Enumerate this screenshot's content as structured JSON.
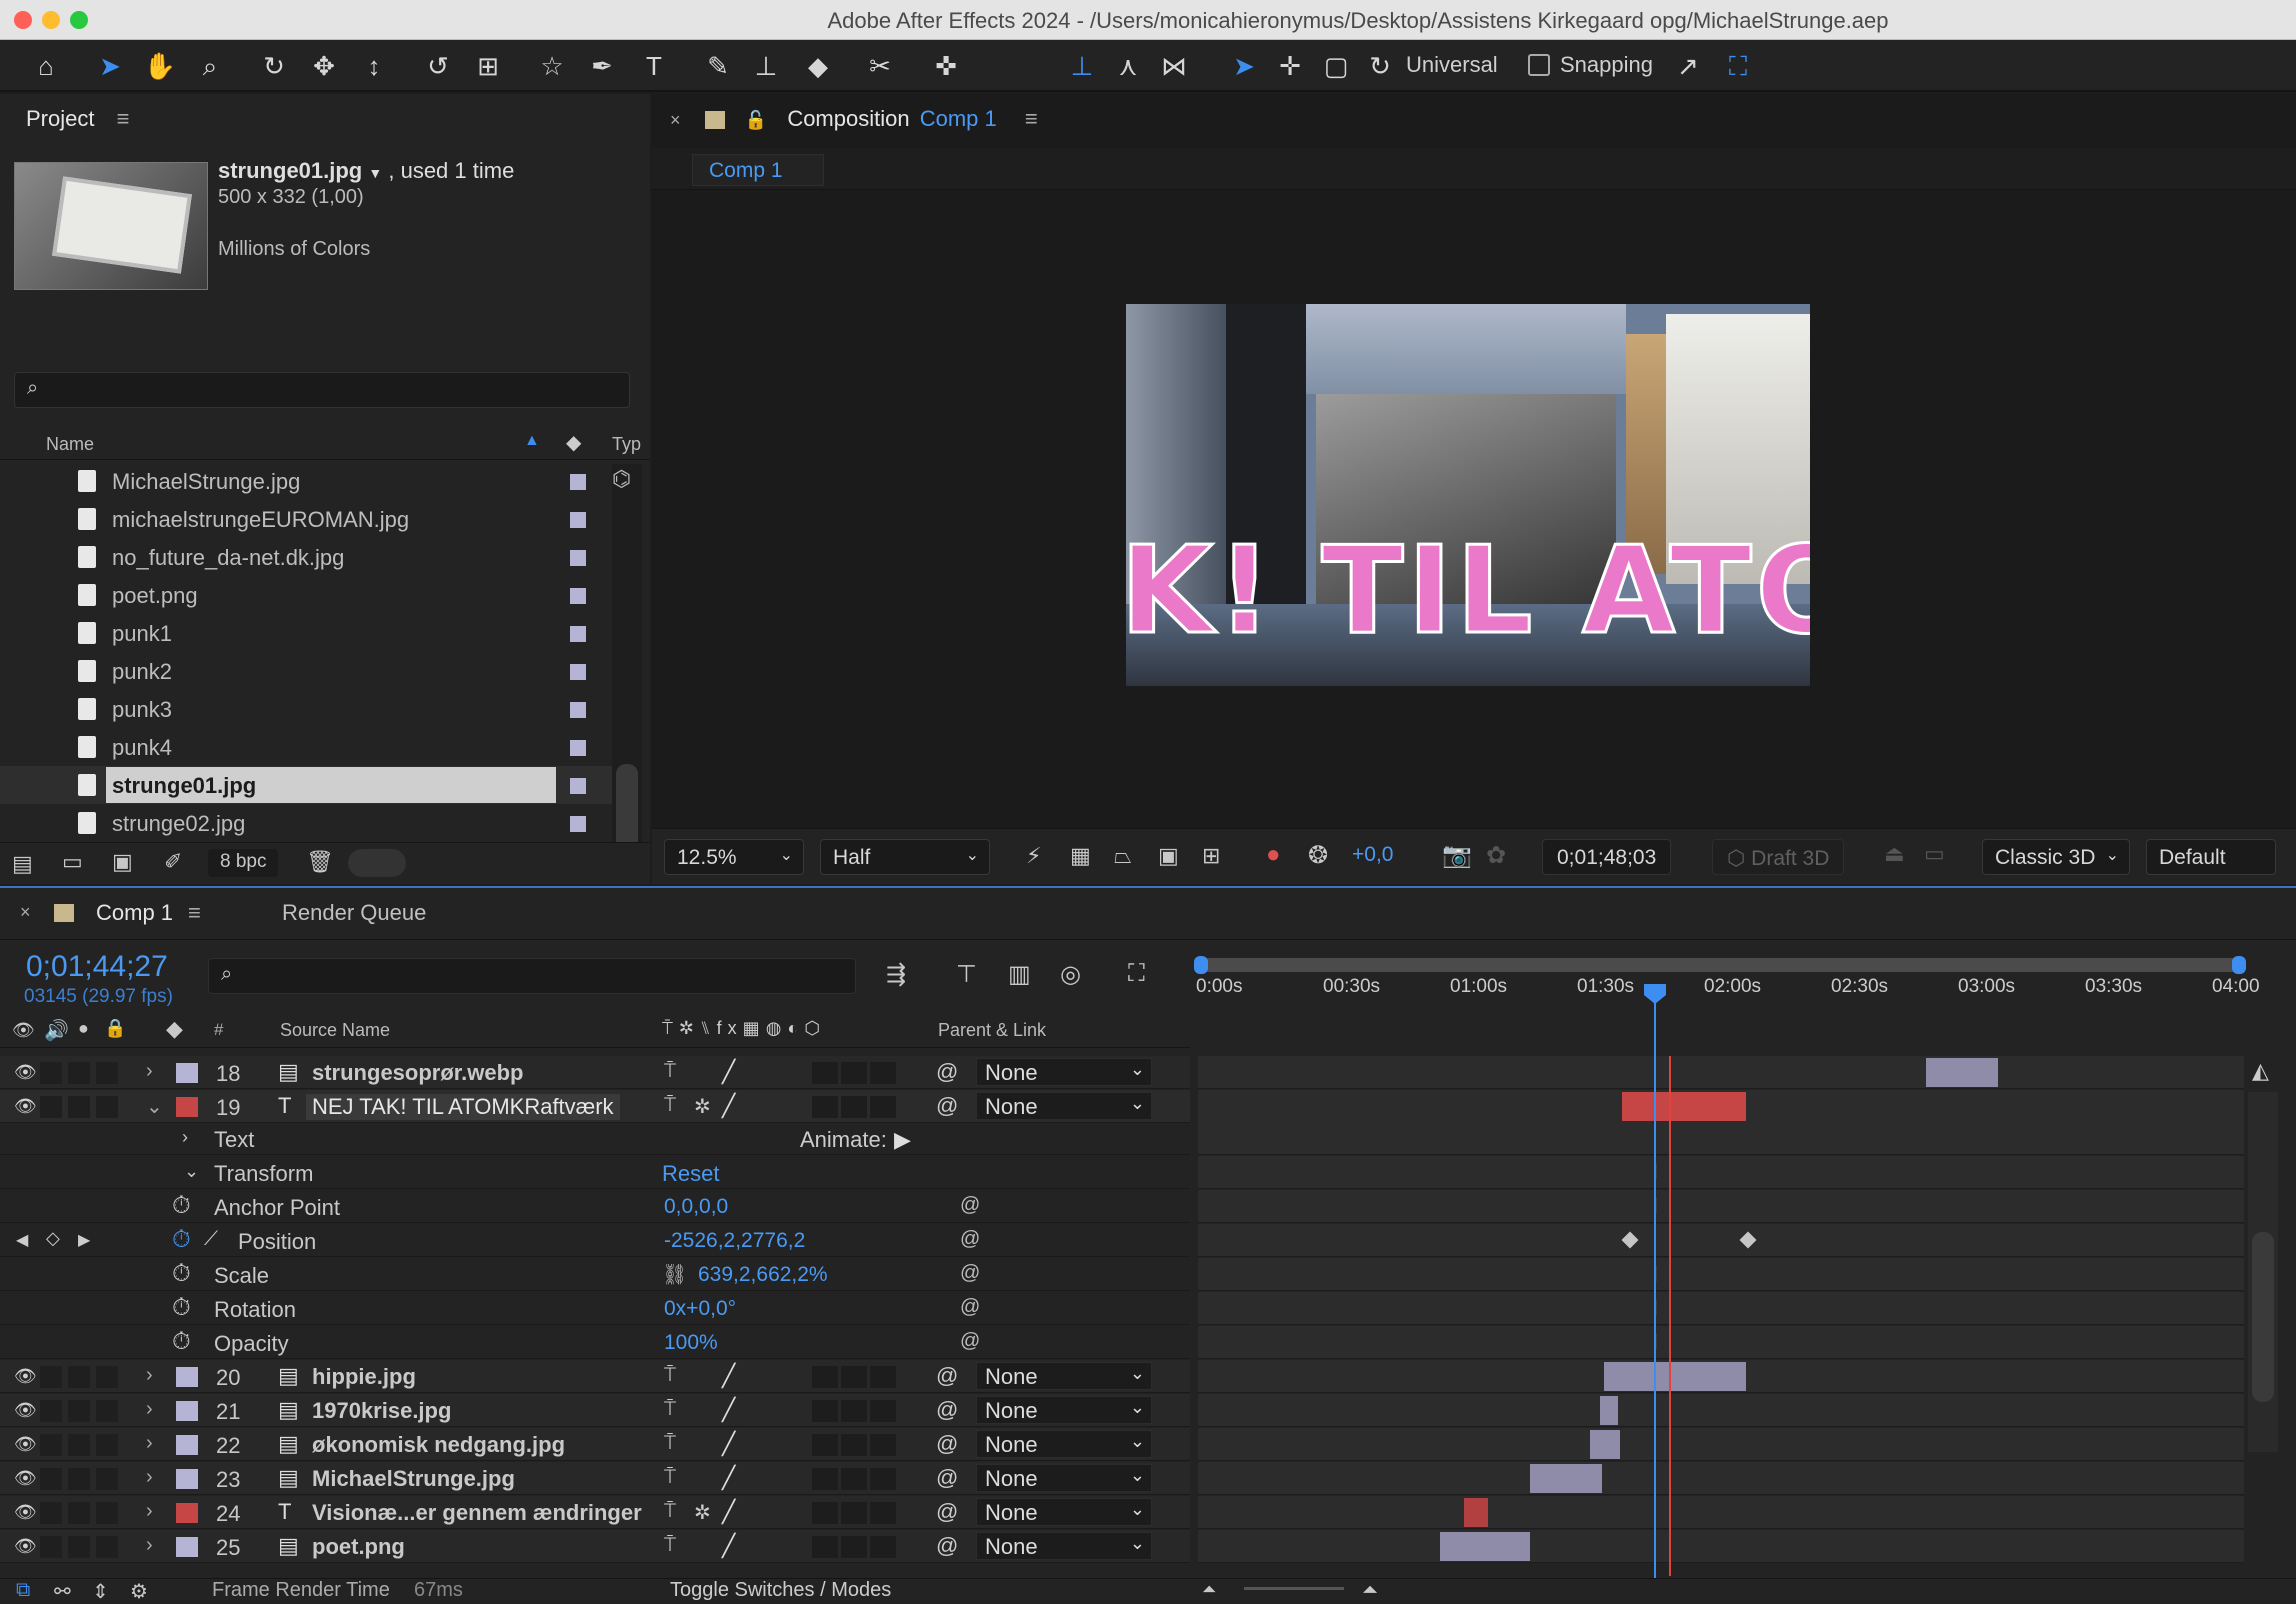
{
  "window": {
    "title": "Adobe After Effects 2024 - /Users/monicahieronymus/Desktop/Assistens Kirkegaard opg/MichaelStrunge.aep"
  },
  "toolbar": {
    "universal_label": "Universal",
    "snapping_label": "Snapping"
  },
  "project": {
    "panel_title": "Project",
    "selected_name": "strunge01.jpg",
    "usage": ", used 1 time",
    "dimensions": "500 x 332 (1,00)",
    "colors": "Millions of Colors",
    "col_name": "Name",
    "col_type": "Typ",
    "items": [
      {
        "name": "MichaelStrunge.jpg"
      },
      {
        "name": "michaelstrungeEUROMAN.jpg"
      },
      {
        "name": "no_future_da-net.dk.jpg"
      },
      {
        "name": "poet.png"
      },
      {
        "name": "punk1"
      },
      {
        "name": "punk2"
      },
      {
        "name": "punk3"
      },
      {
        "name": "punk4"
      },
      {
        "name": "strunge01.jpg"
      },
      {
        "name": "strunge02.jpg"
      }
    ],
    "bpc": "8 bpc"
  },
  "composition": {
    "panel_label": "Composition",
    "comp_name": "Comp 1",
    "tab": "Comp 1",
    "preview_text": "K! TIL ATOM",
    "zoom": "12.5%",
    "resolution": "Half",
    "exposure": "+0,0",
    "timecode": "0;01;48;03",
    "draft3d": "Draft 3D",
    "renderer": "Classic 3D",
    "view": "Default"
  },
  "timeline": {
    "tab": "Comp 1",
    "render_queue": "Render Queue",
    "current_time": "0;01;44;27",
    "frame_info": "03145 (29.97 fps)",
    "col_source": "Source Name",
    "col_parent": "Parent & Link",
    "ruler": [
      "0:00s",
      "00:30s",
      "01:00s",
      "01:30s",
      "02:00s",
      "02:30s",
      "03:00s",
      "03:30s",
      "04:00"
    ],
    "layers_top": [
      {
        "num": "18",
        "type": "img",
        "name": "strungesoprør.webp",
        "color": "#b5b4d4",
        "parent": "None"
      },
      {
        "num": "19",
        "type": "text",
        "name": "NEJ TAK! TIL ATOMKRaftværk",
        "color": "#c64545",
        "parent": "None"
      }
    ],
    "text_group": "Text",
    "animate_label": "Animate:",
    "transform_group": "Transform",
    "reset_label": "Reset",
    "properties": [
      {
        "name": "Anchor Point",
        "value": "0,0,0,0"
      },
      {
        "name": "Position",
        "value": "-2526,2,2776,2"
      },
      {
        "name": "Scale",
        "value": "639,2,662,2%"
      },
      {
        "name": "Rotation",
        "value": "0x+0,0°"
      },
      {
        "name": "Opacity",
        "value": "100%"
      }
    ],
    "layers_bottom": [
      {
        "num": "20",
        "type": "img",
        "name": "hippie.jpg",
        "color": "#b5b4d4",
        "parent": "None"
      },
      {
        "num": "21",
        "type": "img",
        "name": "1970krise.jpg",
        "color": "#b5b4d4",
        "parent": "None"
      },
      {
        "num": "22",
        "type": "img",
        "name": "økonomisk nedgang.jpg",
        "color": "#b5b4d4",
        "parent": "None"
      },
      {
        "num": "23",
        "type": "img",
        "name": "MichaelStrunge.jpg",
        "color": "#b5b4d4",
        "parent": "None"
      },
      {
        "num": "24",
        "type": "text",
        "name": "Visionæ...er gennem ændringer",
        "color": "#c64545",
        "parent": "None"
      },
      {
        "num": "25",
        "type": "img",
        "name": "poet.png",
        "color": "#b5b4d4",
        "parent": "None"
      }
    ],
    "footer_render": "Frame Render Time",
    "footer_ms": "67ms",
    "toggle_label": "Toggle Switches / Modes"
  }
}
